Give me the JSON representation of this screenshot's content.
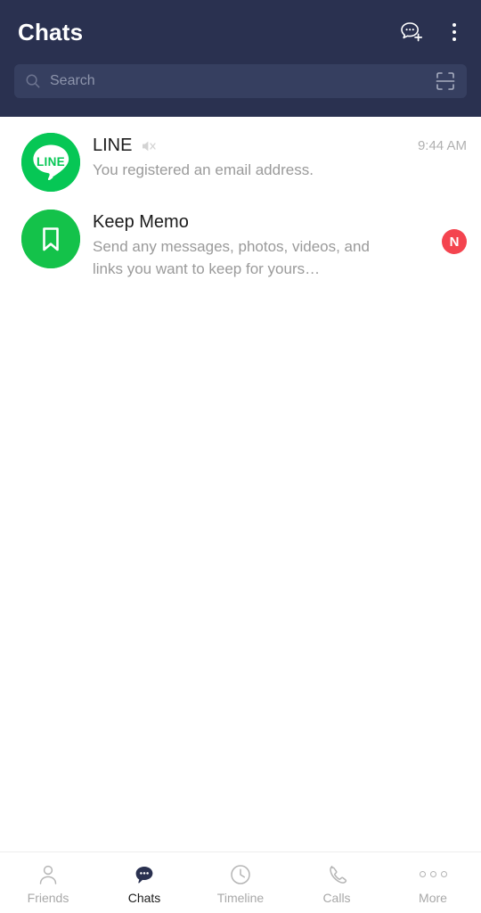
{
  "header": {
    "title": "Chats",
    "new_chat_icon": "new-chat-bubble-plus-icon",
    "menu_icon": "kebab-menu-icon",
    "bg_color": "#2a3150"
  },
  "search": {
    "placeholder": "Search",
    "value": "",
    "search_icon": "magnifier-icon",
    "scan_icon": "qr-scan-icon",
    "bg_color": "#363f60"
  },
  "chats": [
    {
      "name": "LINE",
      "avatar_icon": "line-logo-icon",
      "avatar_label": "LINE",
      "avatar_color": "#06c755",
      "muted": true,
      "mute_icon": "mute-speaker-icon",
      "preview": "You registered an email address.",
      "time": "9:44 AM",
      "badge": ""
    },
    {
      "name": "Keep Memo",
      "avatar_icon": "bookmark-icon",
      "avatar_label": "",
      "avatar_color": "#14c24a",
      "muted": false,
      "mute_icon": "",
      "preview": "Send any messages, photos, videos, and links you want to keep for yours…",
      "time": "",
      "badge": "N",
      "badge_color": "#f4444f"
    }
  ],
  "bottom_nav": {
    "active": "Chats",
    "items": [
      {
        "label": "Friends",
        "icon": "person-outline-icon"
      },
      {
        "label": "Chats",
        "icon": "chat-bubble-filled-icon"
      },
      {
        "label": "Timeline",
        "icon": "clock-outline-icon"
      },
      {
        "label": "Calls",
        "icon": "phone-handset-icon"
      },
      {
        "label": "More",
        "icon": "three-dots-icon"
      }
    ]
  }
}
